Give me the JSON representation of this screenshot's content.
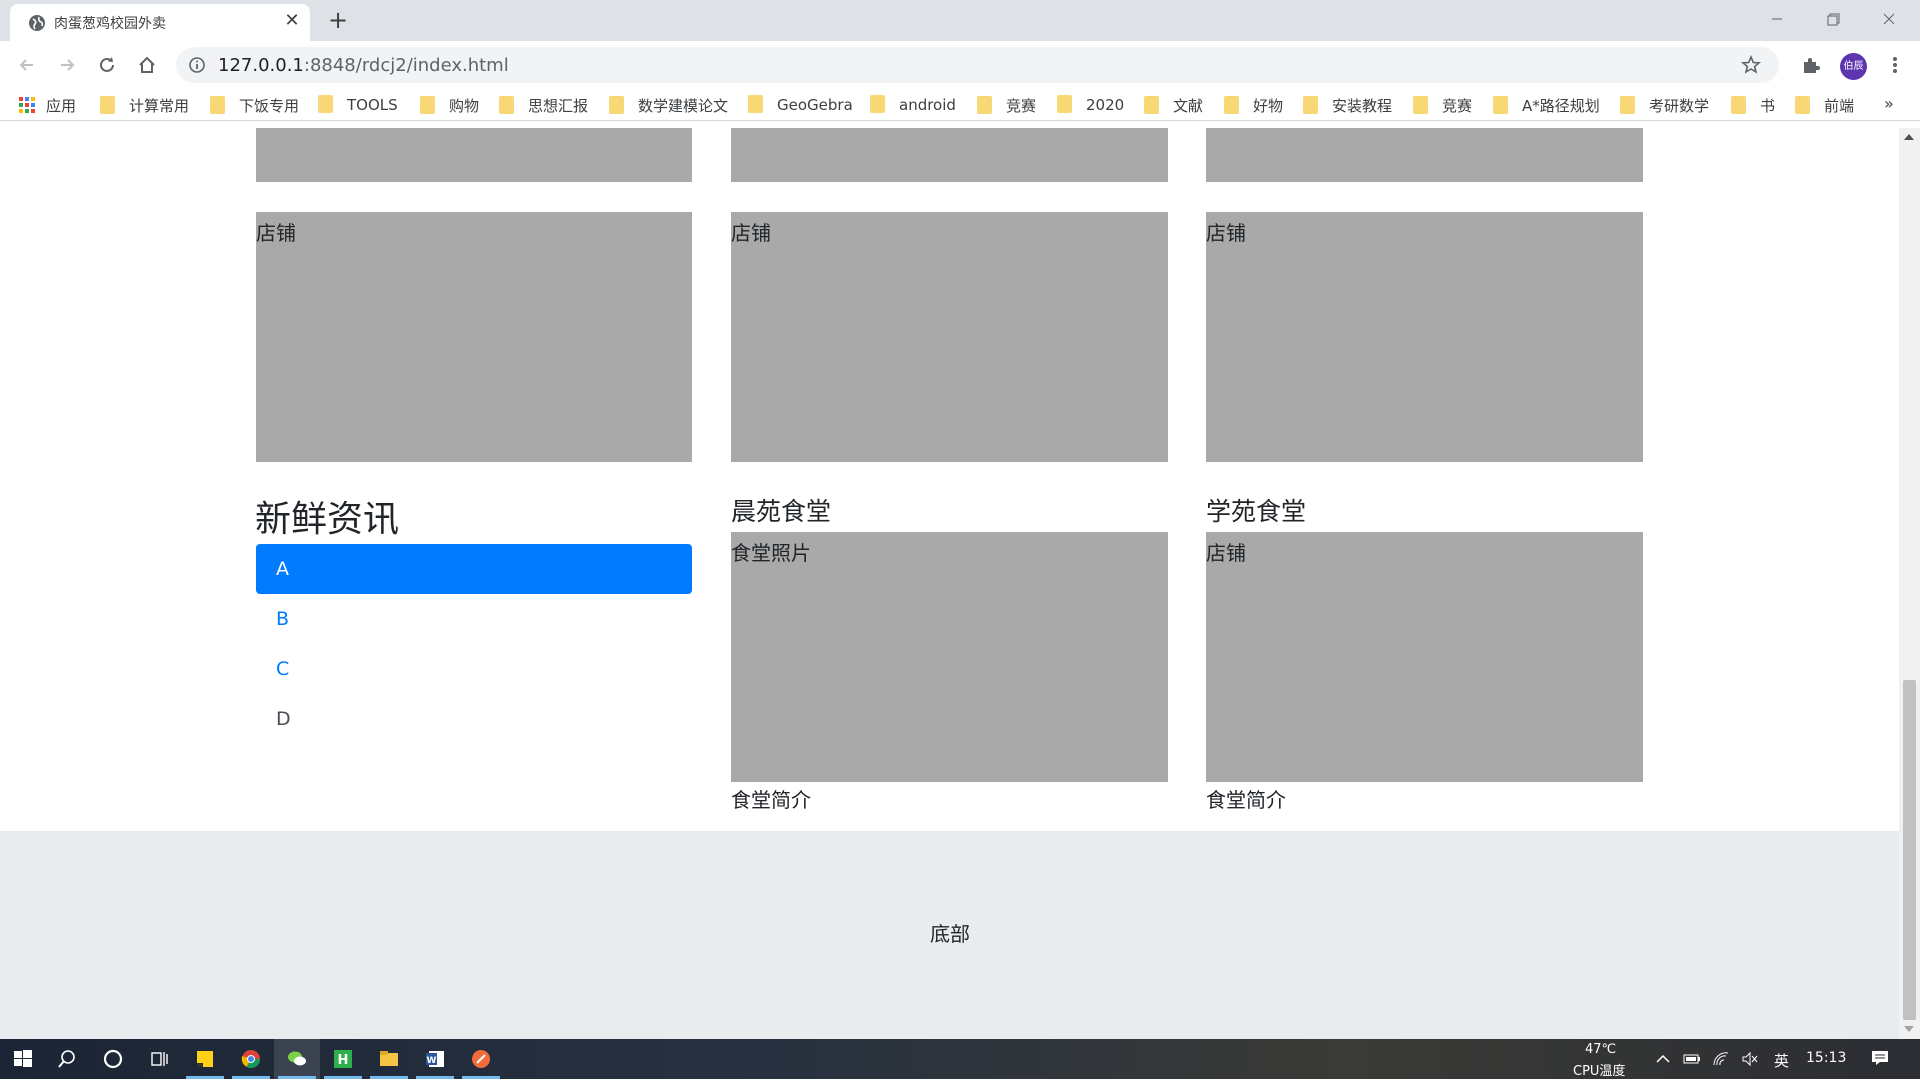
{
  "browser": {
    "tab_title": "肉蛋葱鸡校园外卖",
    "new_tab": "+",
    "url_host": "127.0.0.1",
    "url_rest": ":8848/rdcj2/index.html",
    "avatar_text": "伯辰",
    "bookmarks": [
      "应用",
      "计算常用",
      "下饭专用",
      "TOOLS",
      "购物",
      "思想汇报",
      "数学建模论文",
      "GeoGebra",
      "android",
      "竞赛",
      "2020",
      "文献",
      "好物",
      "安装教程",
      "竞赛",
      "A*路径规划",
      "考研数学",
      "书",
      "前端"
    ],
    "bookmarks_more": "»"
  },
  "page": {
    "shop_label": "店铺",
    "news_title": "新鲜资讯",
    "news_items": [
      "A",
      "B",
      "C",
      "D"
    ],
    "canteen1_title": "晨苑食堂",
    "canteen1_photo": "食堂照片",
    "canteen1_intro": "食堂简介",
    "canteen2_title": "学苑食堂",
    "canteen2_photo": "店铺",
    "canteen2_intro": "食堂简介",
    "footer": "底部"
  },
  "taskbar": {
    "temperature": "47℃",
    "temperature_label": "CPU温度",
    "ime": "英",
    "time": "15:13"
  },
  "colors": {
    "primary": "#007bff",
    "placeholder_gray": "#a9a9a9",
    "footer_bg": "#e9ecef"
  }
}
